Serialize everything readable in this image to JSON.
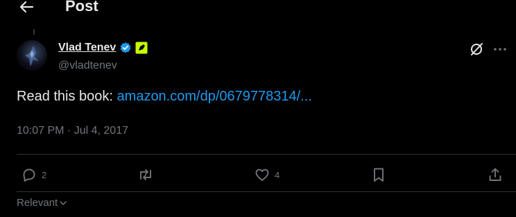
{
  "header": {
    "title": "Post"
  },
  "author": {
    "name": "Vlad Tenev",
    "handle": "@vladtenev"
  },
  "tweet": {
    "text_prefix": "Read this book: ",
    "link_text": "amazon.com/dp/0679778314/...",
    "timestamp": "10:07 PM · Jul 4, 2017"
  },
  "actions": {
    "replies": "2",
    "likes": "4"
  },
  "sort": {
    "label": "Relevant"
  }
}
